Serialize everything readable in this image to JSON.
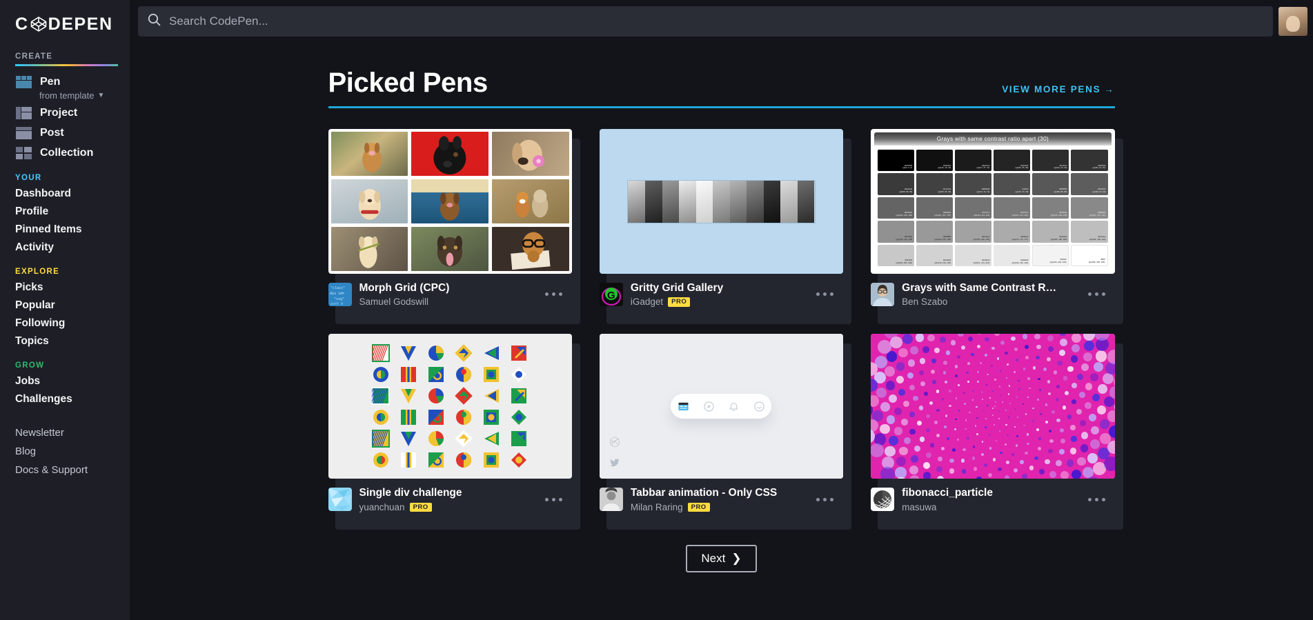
{
  "brand": {
    "name": "CODEPEN",
    "logo_icon": "codepen-logo-icon"
  },
  "sidebar": {
    "sections": [
      {
        "id": "create",
        "label": "CREATE",
        "color": "#9ea3b0"
      },
      {
        "id": "your",
        "label": "YOUR",
        "color": "#47cbff"
      },
      {
        "id": "explore",
        "label": "EXPLORE",
        "color": "#ffdd40"
      },
      {
        "id": "grow",
        "label": "GROW",
        "color": "#2dbb6d"
      }
    ],
    "create": {
      "pen": "Pen",
      "from_template": "from template",
      "project": "Project",
      "post": "Post",
      "collection": "Collection"
    },
    "your": [
      "Dashboard",
      "Profile",
      "Pinned Items",
      "Activity"
    ],
    "explore": [
      "Picks",
      "Popular",
      "Following",
      "Topics"
    ],
    "grow": [
      "Jobs",
      "Challenges"
    ],
    "footer": [
      "Newsletter",
      "Blog",
      "Docs & Support"
    ],
    "collapse_icon": "chevron-left-icon"
  },
  "topbar": {
    "search_placeholder": "Search CodePen...",
    "search_value": "",
    "search_icon": "search-icon",
    "avatar": "user-avatar"
  },
  "page": {
    "title": "Picked Pens",
    "view_more": "VIEW MORE PENS",
    "view_more_icon": "arrow-right-icon",
    "accent_color": "#1fa8d8",
    "link_color": "#3ec1f3"
  },
  "pens": [
    {
      "title": "Morph Grid (CPC)",
      "author": "Samuel Godswill",
      "pro": false,
      "thumb": "dog-photo-grid"
    },
    {
      "title": "Gritty Grid Gallery",
      "author": "iGadget",
      "pro": true,
      "pro_label": "PRO",
      "thumb": "gritty-grid-gallery"
    },
    {
      "title": "Grays with Same Contrast R…",
      "author": "Ben Szabo",
      "pro": false,
      "thumb": "gray-swatches"
    },
    {
      "title": "Single div challenge",
      "author": "yuanchuan",
      "pro": true,
      "pro_label": "PRO",
      "thumb": "shape-icon-grid"
    },
    {
      "title": "Tabbar animation - Only CSS",
      "author": "Milan Raring",
      "pro": true,
      "pro_label": "PRO",
      "thumb": "tabbar-animation"
    },
    {
      "title": "fibonacci_particle",
      "author": "masuwa",
      "pro": false,
      "thumb": "fibonacci-spiral"
    }
  ],
  "grays_thumb": {
    "heading": "Grays with same contrast ratio apart (30)",
    "swatches": [
      {
        "hex": "#000000",
        "rgb": "rgb(0, 0, 0)"
      },
      {
        "hex": "#101010",
        "rgb": "rgb(16, 16, 16)"
      },
      {
        "hex": "#1b1b1b",
        "rgb": "rgb(27, 27, 27)"
      },
      {
        "hex": "#242424",
        "rgb": "rgb(36, 36, 36)"
      },
      {
        "hex": "#2c2c2c",
        "rgb": "rgb(44, 44, 44)"
      },
      {
        "hex": "#333333",
        "rgb": "rgb(51, 51, 51)"
      },
      {
        "hex": "#3a3a3a",
        "rgb": "rgb(58, 58, 58)"
      },
      {
        "hex": "#414141",
        "rgb": "rgb(65, 65, 65)"
      },
      {
        "hex": "#484848",
        "rgb": "rgb(72, 72, 72)"
      },
      {
        "hex": "#4f4f4f",
        "rgb": "rgb(79, 79, 79)"
      },
      {
        "hex": "#585858",
        "rgb": "rgb(88, 88, 88)"
      },
      {
        "hex": "#5d5d5d",
        "rgb": "rgb(93, 93, 93)"
      },
      {
        "hex": "#646464",
        "rgb": "rgb(100, 100, 100)"
      },
      {
        "hex": "#6b6b6b",
        "rgb": "rgb(107, 107, 107)"
      },
      {
        "hex": "#727272",
        "rgb": "rgb(114, 114, 114)"
      },
      {
        "hex": "#797979",
        "rgb": "rgb(121, 121, 121)"
      },
      {
        "hex": "#818181",
        "rgb": "rgb(129, 129, 129)"
      },
      {
        "hex": "#898989",
        "rgb": "rgb(137, 137, 137)"
      },
      {
        "hex": "#919191",
        "rgb": "rgb(145, 145, 145)"
      },
      {
        "hex": "#999999",
        "rgb": "rgb(153, 153, 153)"
      },
      {
        "hex": "#a2a2a2",
        "rgb": "rgb(162, 162, 162)"
      },
      {
        "hex": "#ababab",
        "rgb": "rgb(171, 171, 171)"
      },
      {
        "hex": "#b4b4b4",
        "rgb": "rgb(180, 180, 180)"
      },
      {
        "hex": "#bebebe",
        "rgb": "rgb(190, 190, 190)"
      },
      {
        "hex": "#c8c8c8",
        "rgb": "rgb(200, 200, 200)"
      },
      {
        "hex": "#d2d2d2",
        "rgb": "rgb(210, 210, 210)"
      },
      {
        "hex": "#dddddd",
        "rgb": "rgb(221, 221, 221)"
      },
      {
        "hex": "#e8e8e8",
        "rgb": "rgb(232, 232, 232)"
      },
      {
        "hex": "#f3f3f3",
        "rgb": "rgb(243, 243, 243)"
      },
      {
        "hex": "#ffffff",
        "rgb": "rgb(255, 255, 255)"
      }
    ]
  },
  "tabbar_thumb": {
    "icons": [
      "news-card-icon",
      "compass-icon",
      "bell-icon",
      "smiley-icon"
    ],
    "active_index": 0,
    "social": [
      "dribbble-icon",
      "twitter-icon"
    ]
  },
  "pager": {
    "next": "Next",
    "next_icon": "chevron-right-icon"
  },
  "pen_menu_icon": "more-options-icon"
}
